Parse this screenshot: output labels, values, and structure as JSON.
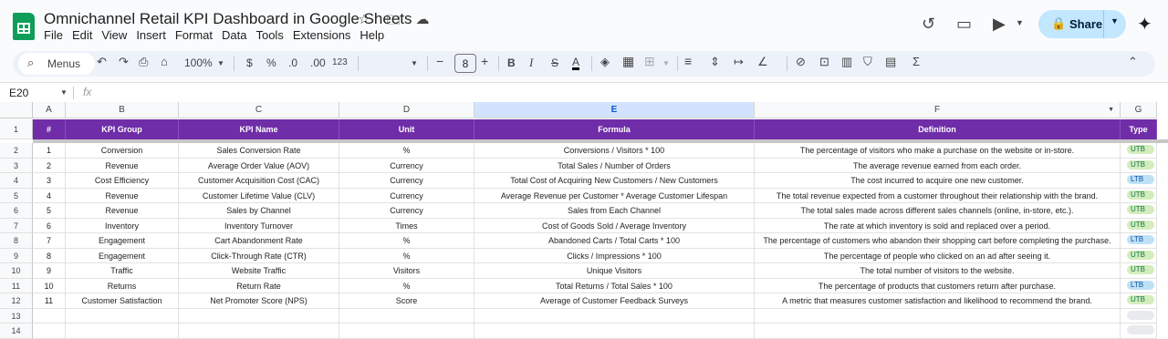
{
  "app": {
    "doc_title": "Omnichannel Retail KPI Dashboard in Google Sheets",
    "menu": [
      "File",
      "Edit",
      "View",
      "Insert",
      "Format",
      "Data",
      "Tools",
      "Extensions",
      "Help"
    ],
    "share_label": "Share",
    "title_icons": [
      "star-icon",
      "move-to-folder-icon",
      "cloud-status-icon"
    ],
    "right_icons": [
      "history-icon",
      "comments-icon",
      "meet-icon",
      "gemini-icon"
    ]
  },
  "toolbar": {
    "menus_label": "Menus",
    "zoom": "100%",
    "currency": "$",
    "percent": "%",
    "dec_decrease": ".0",
    "dec_increase": ".00",
    "number_format": "123",
    "font_size": "8",
    "minus": "−",
    "plus": "+",
    "bold": "B",
    "italic": "I",
    "strike": "S",
    "text_color": "A",
    "sum": "Σ"
  },
  "formula_bar": {
    "name_box": "E20",
    "fx": "fx"
  },
  "columns": [
    "A",
    "B",
    "C",
    "D",
    "E",
    "F",
    "G"
  ],
  "selected_column": "E",
  "header_row": [
    "#",
    "KPI Group",
    "KPI Name",
    "Unit",
    "Formula",
    "Definition",
    "Type"
  ],
  "rows": [
    [
      "1",
      "Conversion",
      "Sales Conversion Rate",
      "%",
      "Conversions / Visitors * 100",
      "The percentage of visitors who make a purchase on the website or in-store.",
      "UTB"
    ],
    [
      "2",
      "Revenue",
      "Average Order Value (AOV)",
      "Currency",
      "Total Sales / Number of Orders",
      "The average revenue earned from each order.",
      "UTB"
    ],
    [
      "3",
      "Cost Efficiency",
      "Customer Acquisition Cost (CAC)",
      "Currency",
      "Total Cost of Acquiring New Customers / New Customers",
      "The cost incurred to acquire one new customer.",
      "LTB"
    ],
    [
      "4",
      "Revenue",
      "Customer Lifetime Value (CLV)",
      "Currency",
      "Average Revenue per Customer * Average Customer Lifespan",
      "The total revenue expected from a customer throughout their relationship with the brand.",
      "UTB"
    ],
    [
      "5",
      "Revenue",
      "Sales by Channel",
      "Currency",
      "Sales from Each Channel",
      "The total sales made across different sales channels (online, in-store, etc.).",
      "UTB"
    ],
    [
      "6",
      "Inventory",
      "Inventory Turnover",
      "Times",
      "Cost of Goods Sold / Average Inventory",
      "The rate at which inventory is sold and replaced over a period.",
      "UTB"
    ],
    [
      "7",
      "Engagement",
      "Cart Abandonment Rate",
      "%",
      "Abandoned Carts / Total Carts * 100",
      "The percentage of customers who abandon their shopping cart before completing the purchase.",
      "LTB"
    ],
    [
      "8",
      "Engagement",
      "Click-Through Rate (CTR)",
      "%",
      "Clicks / Impressions * 100",
      "The percentage of people who clicked on an ad after seeing it.",
      "UTB"
    ],
    [
      "9",
      "Traffic",
      "Website Traffic",
      "Visitors",
      "Unique Visitors",
      "The total number of visitors to the website.",
      "UTB"
    ],
    [
      "10",
      "Returns",
      "Return Rate",
      "%",
      "Total Returns / Total Sales * 100",
      "The percentage of products that customers return after purchase.",
      "LTB"
    ],
    [
      "11",
      "Customer Satisfaction",
      "Net Promoter Score (NPS)",
      "Score",
      "Average of Customer Feedback Surveys",
      "A metric that measures customer satisfaction and likelihood to recommend the brand.",
      "UTB"
    ]
  ],
  "row_numbers": [
    "1",
    "2",
    "3",
    "4",
    "5",
    "6",
    "7",
    "8",
    "9",
    "10",
    "11",
    "12",
    "13",
    "14"
  ],
  "colors": {
    "header_bg": "#6f2da8",
    "utb_chip": "#d4edbc",
    "ltb_chip": "#bfe1f6",
    "share_bg": "#c2e7ff"
  }
}
